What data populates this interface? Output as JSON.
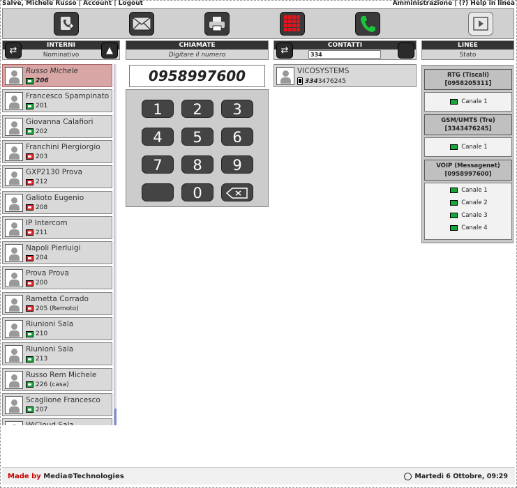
{
  "topbar": {
    "left": "Salve, Michele Russo | Account | Logout",
    "right": "Amministrazione | (?) Help in linea"
  },
  "toolbar": {
    "icons": [
      "contact-add-icon",
      "mail-icon",
      "printer-icon",
      "grid-icon",
      "phone-icon",
      "play-icon"
    ]
  },
  "interni": {
    "title": "INTERNI",
    "subtitle": "Nominativo",
    "items": [
      {
        "name": "Russo Michele",
        "ext": "206",
        "status": "green",
        "selected": true
      },
      {
        "name": "Francesco Spampinato",
        "ext": "201",
        "status": "green"
      },
      {
        "name": "Giovanna Calafiori",
        "ext": "202",
        "status": "green"
      },
      {
        "name": "Franchini Piergiorgio",
        "ext": "203",
        "status": "red"
      },
      {
        "name": "GXP2130 Prova",
        "ext": "212",
        "status": "red"
      },
      {
        "name": "Galioto Eugenio",
        "ext": "208",
        "status": "red"
      },
      {
        "name": "IP Intercom",
        "ext": "211",
        "status": "red"
      },
      {
        "name": "Napoli Pierluigi",
        "ext": "204",
        "status": "red"
      },
      {
        "name": "Prova Prova",
        "ext": "200",
        "status": "red"
      },
      {
        "name": "Rametta Corrado",
        "ext": "205 (Remoto)",
        "status": "red"
      },
      {
        "name": "Riunioni Sala",
        "ext": "210",
        "status": "green"
      },
      {
        "name": "Riunioni Sala",
        "ext": "213",
        "status": "green"
      },
      {
        "name": "Russo Rem Michele",
        "ext": "226 (casa)",
        "status": "green"
      },
      {
        "name": "Scaglione Francesco",
        "ext": "207",
        "status": "green"
      },
      {
        "name": "WiCloud Sala",
        "ext": "",
        "status": "green"
      }
    ]
  },
  "chiamate": {
    "title": "CHIAMATE",
    "subtitle": "Digitare il numero",
    "number": "0958997600",
    "keys": [
      "1",
      "2",
      "3",
      "4",
      "5",
      "6",
      "7",
      "8",
      "9",
      "",
      "0",
      ""
    ]
  },
  "contatti": {
    "title": "CONTATTI",
    "search_value": "334",
    "results": [
      {
        "name": "VICOSYSTEMS",
        "phone_match": "334",
        "phone_rest": "3476245"
      }
    ]
  },
  "linee": {
    "title": "LINEE",
    "subtitle": "Stato",
    "groups": [
      {
        "name": "RTG (Tiscali)",
        "number": "[0958205311]",
        "channels": [
          "Canale 1"
        ]
      },
      {
        "name": "GSM/UMTS (Tre)",
        "number": "[3343476245]",
        "channels": [
          "Canale 1"
        ]
      },
      {
        "name": "VOIP (Messagenet)",
        "number": "[0958997600]",
        "channels": [
          "Canale 1",
          "Canale 2",
          "Canale 3",
          "Canale 4"
        ]
      }
    ]
  },
  "footer": {
    "made_by": "Made by",
    "brand": "Media",
    "brand_mark": "⊕",
    "brand_rest": "Technologies",
    "datetime": "Martedì 6 Ottobre, 09:29"
  },
  "colors": {
    "status_green": "#1aa53a",
    "status_red": "#e0262a",
    "selected_bg": "#d9a6a6"
  }
}
